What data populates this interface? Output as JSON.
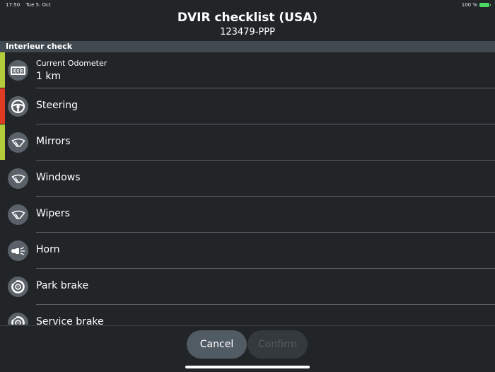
{
  "status_bar": {
    "time": "17:50",
    "date": "Tue 5. Oct",
    "battery": "100 %"
  },
  "header": {
    "title": "DVIR checklist (USA)",
    "subtitle": "123479-PPP"
  },
  "section": {
    "title": "Interieur check"
  },
  "odometer": {
    "label": "Current Odometer",
    "value": "1 km",
    "icon": "odometer-icon",
    "status": "ok"
  },
  "items": [
    {
      "label": "Steering",
      "icon": "steering-wheel-icon",
      "status": "defect"
    },
    {
      "label": "Mirrors",
      "icon": "windshield-wiper-icon",
      "status": "ok"
    },
    {
      "label": "Windows",
      "icon": "windshield-wiper-icon",
      "status": "none"
    },
    {
      "label": "Wipers",
      "icon": "windshield-wiper-icon",
      "status": "none"
    },
    {
      "label": "Horn",
      "icon": "horn-icon",
      "status": "none"
    },
    {
      "label": "Park brake",
      "icon": "brake-disc-icon",
      "status": "none"
    },
    {
      "label": "Service brake",
      "icon": "brake-disc-icon",
      "status": "none"
    }
  ],
  "footer": {
    "cancel_label": "Cancel",
    "confirm_label": "Confirm"
  },
  "colors": {
    "ok": "#b3cc3a",
    "defect": "#e03a22",
    "background": "#222528",
    "section": "#424a51"
  }
}
